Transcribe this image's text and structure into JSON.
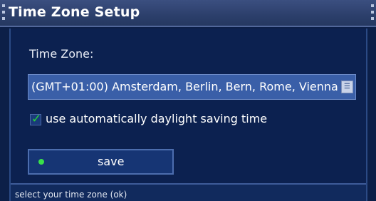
{
  "window": {
    "title": "Time Zone Setup"
  },
  "form": {
    "time_zone_label": "Time Zone:",
    "time_zone_value": "(GMT+01:00) Amsterdam, Berlin, Bern, Rome, Vienna",
    "dropdown_icon": "list-icon",
    "dst_checkbox_checked": true,
    "dst_checkbox_label": "use automatically daylight saving time",
    "save_label": "save",
    "save_indicator_color": "#39e04a"
  },
  "status": {
    "hint": "select your time zone (ok)"
  },
  "colors": {
    "background": "#0c1f48",
    "titlebar": "#2c3f6b",
    "selected_field": "#3a5fa8",
    "checkmark": "#27d23a"
  }
}
